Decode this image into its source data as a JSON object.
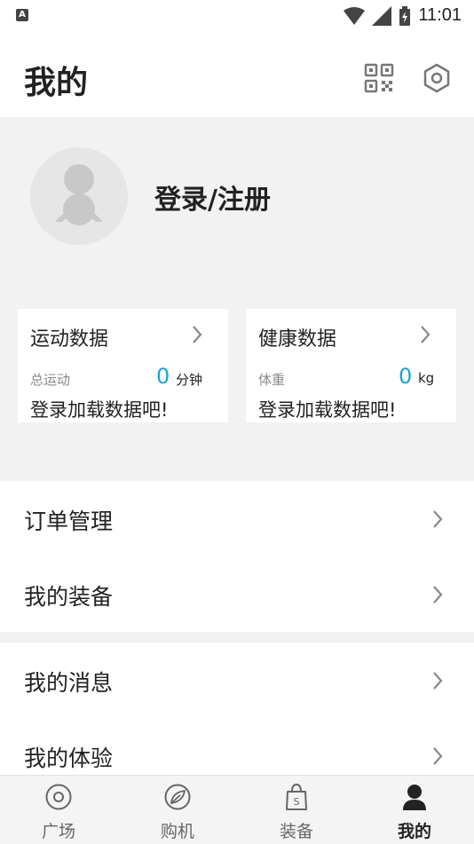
{
  "status_bar": {
    "time": "11:01",
    "left_badge": "A"
  },
  "header": {
    "title": "我的"
  },
  "profile": {
    "login_label": "登录/注册"
  },
  "cards": [
    {
      "title": "运动数据",
      "sub_label": "总运动",
      "value": "0",
      "unit": "分钟",
      "footer": "登录加载数据吧!"
    },
    {
      "title": "健康数据",
      "sub_label": "体重",
      "value": "0",
      "unit": "kg",
      "footer": "登录加载数据吧!"
    }
  ],
  "menu_group_1": [
    {
      "label": "订单管理"
    },
    {
      "label": "我的装备"
    }
  ],
  "menu_group_2": [
    {
      "label": "我的消息"
    },
    {
      "label": "我的体验"
    }
  ],
  "tabbar": {
    "items": [
      {
        "label": "广场",
        "icon": "circle-target-icon"
      },
      {
        "label": "购机",
        "icon": "leaf-icon"
      },
      {
        "label": "装备",
        "icon": "shopping-bag-icon"
      },
      {
        "label": "我的",
        "icon": "person-icon",
        "active": true
      }
    ]
  },
  "colors": {
    "accent": "#1aa3d9",
    "background": "#f2f2f2",
    "card": "#ffffff"
  }
}
